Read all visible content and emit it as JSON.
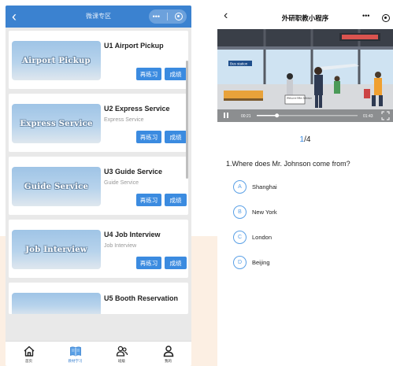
{
  "left_phone": {
    "header": {
      "back_icon": "‹",
      "title": "微课专区"
    },
    "courses": [
      {
        "thumb_text": "Airport Pickup",
        "title": "U1 Airport Pickup",
        "subtitle": "",
        "practice_label": "再练习",
        "score_label": "成绩"
      },
      {
        "thumb_text": "Express Service",
        "title": "U2 Express Service",
        "subtitle": "Express Service",
        "practice_label": "再练习",
        "score_label": "成绩"
      },
      {
        "thumb_text": "Guide Service",
        "title": "U3 Guide Service",
        "subtitle": "Guide Service",
        "practice_label": "再练习",
        "score_label": "成绩"
      },
      {
        "thumb_text": "Job Interview",
        "title": "U4 Job Interview",
        "subtitle": "Job Interview",
        "practice_label": "再练习",
        "score_label": "成绩"
      },
      {
        "thumb_text": "",
        "title": "U5 Booth Reservation",
        "subtitle": "",
        "practice_label": "",
        "score_label": ""
      }
    ],
    "tabbar": [
      {
        "icon": "home-icon",
        "label": "首页",
        "active": false
      },
      {
        "icon": "book-icon",
        "label": "教材学习",
        "active": true
      },
      {
        "icon": "group-icon",
        "label": "班级",
        "active": false
      },
      {
        "icon": "user-icon",
        "label": "我的",
        "active": false
      }
    ]
  },
  "right_phone": {
    "header": {
      "back_icon": "‹",
      "title": "外研职教小程序"
    },
    "video": {
      "current_time": "00:21",
      "total_time": "01:43",
      "progress": 0.2,
      "sign_text": "Bus station",
      "welcome_text": "Welcome Mike Johnson"
    },
    "counter": {
      "current": "1",
      "total": "/4"
    },
    "question": "1.Where does Mr. Johnson come from?",
    "options": [
      {
        "letter": "A",
        "text": "Shanghai"
      },
      {
        "letter": "B",
        "text": "New York"
      },
      {
        "letter": "C",
        "text": "London"
      },
      {
        "letter": "D",
        "text": "Beijing"
      }
    ]
  },
  "colors": {
    "accent": "#3b82d0",
    "button": "#3b8be0",
    "background_band": "#fcefe3"
  }
}
